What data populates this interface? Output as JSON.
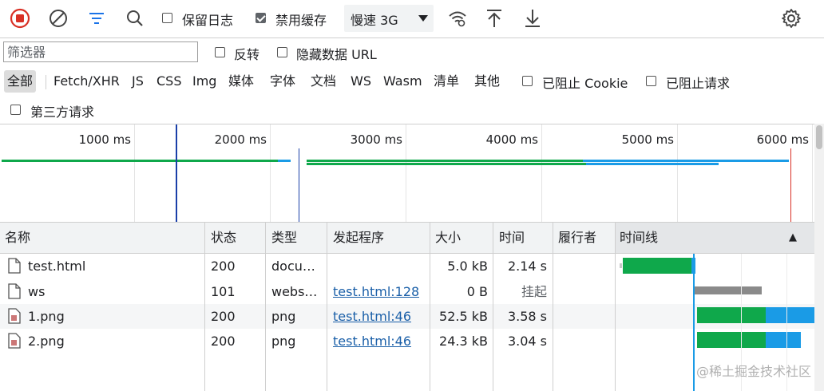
{
  "toolbar": {
    "preserve_log_label": "保留日志",
    "preserve_log_checked": false,
    "disable_cache_label": "禁用缓存",
    "disable_cache_checked": true,
    "throttling_value": "慢速 3G",
    "icons": [
      "record-stop-icon",
      "clear-icon",
      "filter-icon",
      "search-icon",
      "wifi-settings-icon",
      "upload-icon",
      "download-icon",
      "gear-icon"
    ]
  },
  "filter": {
    "placeholder": "筛选器",
    "invert_label": "反转",
    "hide_data_url_label": "隐藏数据 URL"
  },
  "types": [
    "全部",
    "Fetch/XHR",
    "JS",
    "CSS",
    "Img",
    "媒体",
    "字体",
    "文档",
    "WS",
    "Wasm",
    "清单",
    "其他"
  ],
  "types_active": "全部",
  "blocked": {
    "cookie_label": "已阻止 Cookie",
    "requests_label": "已阻止请求",
    "third_party_label": "第三方请求"
  },
  "overview": {
    "ticks": [
      "1000 ms",
      "2000 ms",
      "3000 ms",
      "4000 ms",
      "5000 ms",
      "6000 ms"
    ]
  },
  "table": {
    "columns": [
      "名称",
      "状态",
      "类型",
      "发起程序",
      "大小",
      "时间",
      "履行者",
      "时间线"
    ],
    "sort_indicator": "▲",
    "rows": [
      {
        "name": "test.html",
        "status": "200",
        "type": "docu…",
        "initiator": "",
        "size": "5.0 kB",
        "time": "2.14 s",
        "icon": "document-icon"
      },
      {
        "name": "ws",
        "status": "101",
        "type": "webs…",
        "initiator": "test.html:128",
        "size": "0 B",
        "time": "挂起",
        "icon": "document-icon"
      },
      {
        "name": "1.png",
        "status": "200",
        "type": "png",
        "initiator": "test.html:46",
        "size": "52.5 kB",
        "time": "3.58 s",
        "icon": "image-file-icon"
      },
      {
        "name": "2.png",
        "status": "200",
        "type": "png",
        "initiator": "test.html:46",
        "size": "24.3 kB",
        "time": "3.04 s",
        "icon": "image-file-icon"
      }
    ]
  },
  "watermark": "@稀土掘金技术社区",
  "colors": {
    "record": "#d93025",
    "filter_active": "#1a73e8",
    "waiting": "#0fa84b",
    "download": "#1a9be6",
    "pending": "#8a8a8a",
    "dom_line": "#1a3fa8",
    "load_line": "#d93025"
  }
}
